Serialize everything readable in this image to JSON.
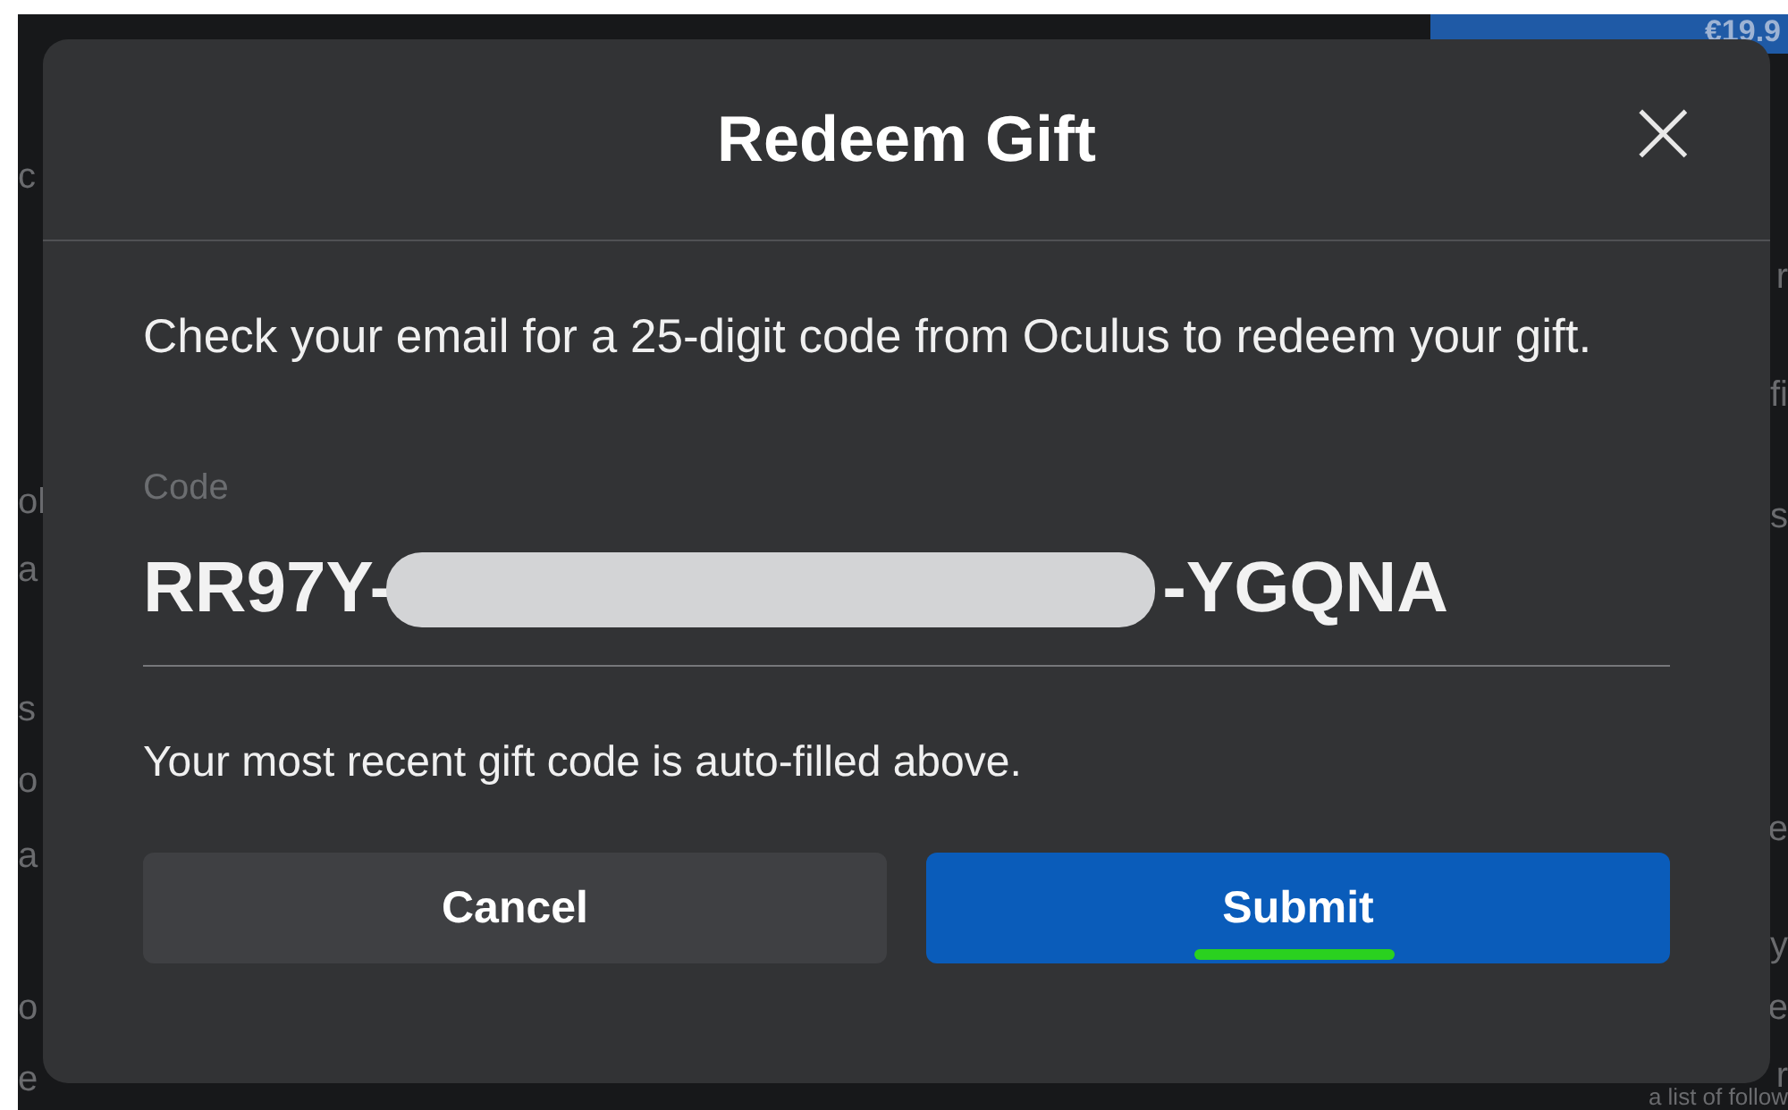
{
  "background": {
    "price": "€19.9",
    "left_fragments": [
      "c",
      "ol",
      "a",
      "s",
      "o",
      "a",
      "o",
      "e"
    ],
    "right_fragments": [
      "r",
      "fi",
      "s",
      "e",
      "y",
      "e",
      "r"
    ],
    "bottom_text": "a list of follow"
  },
  "dialog": {
    "title": "Redeem Gift",
    "close": "×",
    "message": "Check your email for a 25-digit code from Oculus to redeem your gift.",
    "field": {
      "label": "Code",
      "value_start": "RR97Y-",
      "value_end": "-YGQNA",
      "redacted": true
    },
    "helper": "Your most recent gift code is auto-filled above.",
    "buttons": [
      {
        "label": "Cancel",
        "kind": "secondary",
        "underlined": false
      },
      {
        "label": "Submit",
        "kind": "primary",
        "underlined": true
      }
    ]
  }
}
